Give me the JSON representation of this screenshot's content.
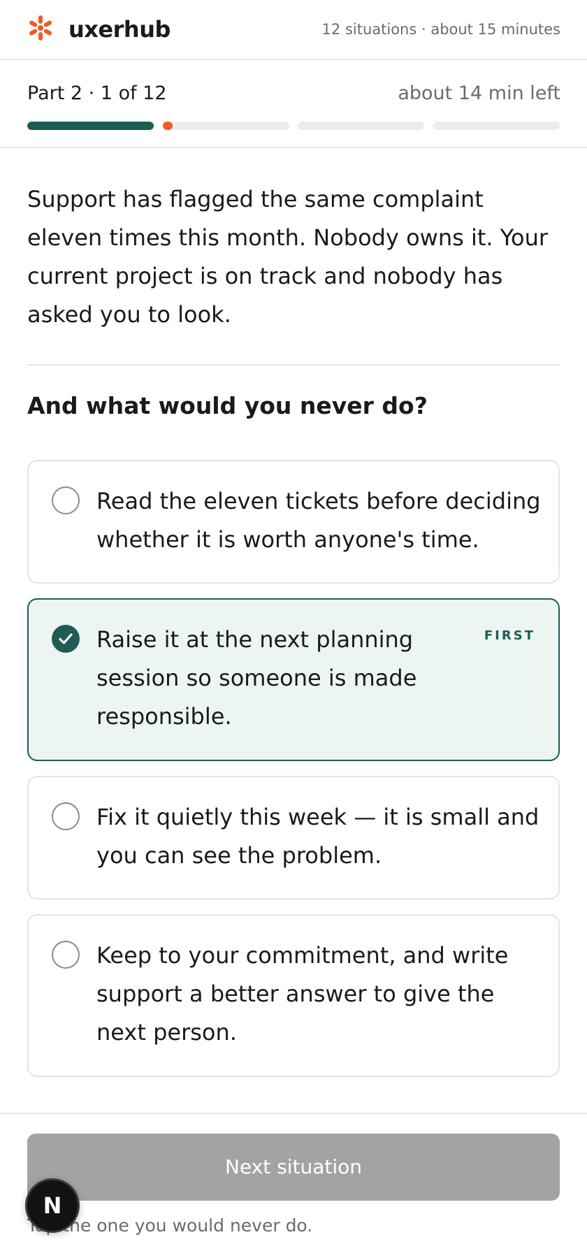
{
  "header": {
    "brand": "uxerhub",
    "logo_icon": "asterisk-burst-icon",
    "meta": "12 situations · about 15 minutes"
  },
  "progress": {
    "part_label": "Part 2 · 1 of 12",
    "time_left": "about 14 min left",
    "segments": [
      {
        "state": "done",
        "fill": 1.0
      },
      {
        "state": "current",
        "fill": 0.08
      },
      {
        "state": "upcoming",
        "fill": 0.0
      },
      {
        "state": "upcoming",
        "fill": 0.0
      }
    ]
  },
  "scenario": {
    "text": "Support has flagged the same complaint eleven times this month. Nobody owns it. Your current project is on track and nobody has asked you to look."
  },
  "question": "And what would you never do?",
  "options": [
    {
      "text": "Read the eleven tickets before deciding whether it is worth anyone's time.",
      "selected": false,
      "badge": ""
    },
    {
      "text": "Raise it at the next planning session so someone is made responsible.",
      "selected": true,
      "badge": "FIRST"
    },
    {
      "text": "Fix it quietly this week — it is small and you can see the problem.",
      "selected": false,
      "badge": ""
    },
    {
      "text": "Keep to your commitment, and write support a better answer to give the next person.",
      "selected": false,
      "badge": ""
    }
  ],
  "footer": {
    "next_label": "Next situation",
    "hint": "Tap the one you would never do.",
    "fab_label": "N"
  },
  "colors": {
    "accent": "#1e5c54",
    "brand_orange": "#f05a28",
    "selected_bg": "#edf5f2",
    "disabled_button": "#a3a3a3"
  }
}
